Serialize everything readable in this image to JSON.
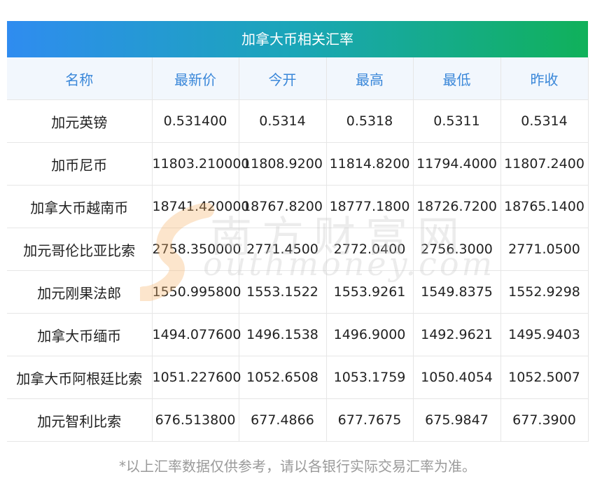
{
  "title": "加拿大币相关汇率",
  "headers": [
    "名称",
    "最新价",
    "今开",
    "最高",
    "最低",
    "昨收"
  ],
  "rows": [
    [
      "加元英镑",
      "0.531400",
      "0.5314",
      "0.5318",
      "0.5311",
      "0.5314"
    ],
    [
      "加币尼币",
      "11803.210000",
      "11808.9200",
      "11814.8200",
      "11794.4000",
      "11807.2400"
    ],
    [
      "加拿大币越南币",
      "18741.420000",
      "18767.8200",
      "18777.1800",
      "18726.7200",
      "18765.1400"
    ],
    [
      "加元哥伦比亚比索",
      "2758.350000",
      "2771.4500",
      "2772.0400",
      "2756.3000",
      "2771.0500"
    ],
    [
      "加元刚果法郎",
      "1550.995800",
      "1553.1522",
      "1553.9261",
      "1549.8375",
      "1552.9298"
    ],
    [
      "加拿大币缅币",
      "1494.077600",
      "1496.1538",
      "1496.9000",
      "1492.9621",
      "1495.9403"
    ],
    [
      "加拿大币阿根廷比索",
      "1051.227600",
      "1052.6508",
      "1053.1759",
      "1050.4054",
      "1052.5007"
    ],
    [
      "加元智利比索",
      "676.513800",
      "677.4866",
      "677.7675",
      "675.9847",
      "677.3900"
    ]
  ],
  "footnote": "*以上汇率数据仅供参考，请以各银行实际交易汇率为准。",
  "watermark": {
    "text_cn": "南方财富网",
    "text_en": "outhmoney.com"
  },
  "colors": {
    "title_gradient_start": "#2f8cf0",
    "title_gradient_end": "#10b15a",
    "header_text": "#3a87d9",
    "header_bg": "#f2f7fd"
  }
}
